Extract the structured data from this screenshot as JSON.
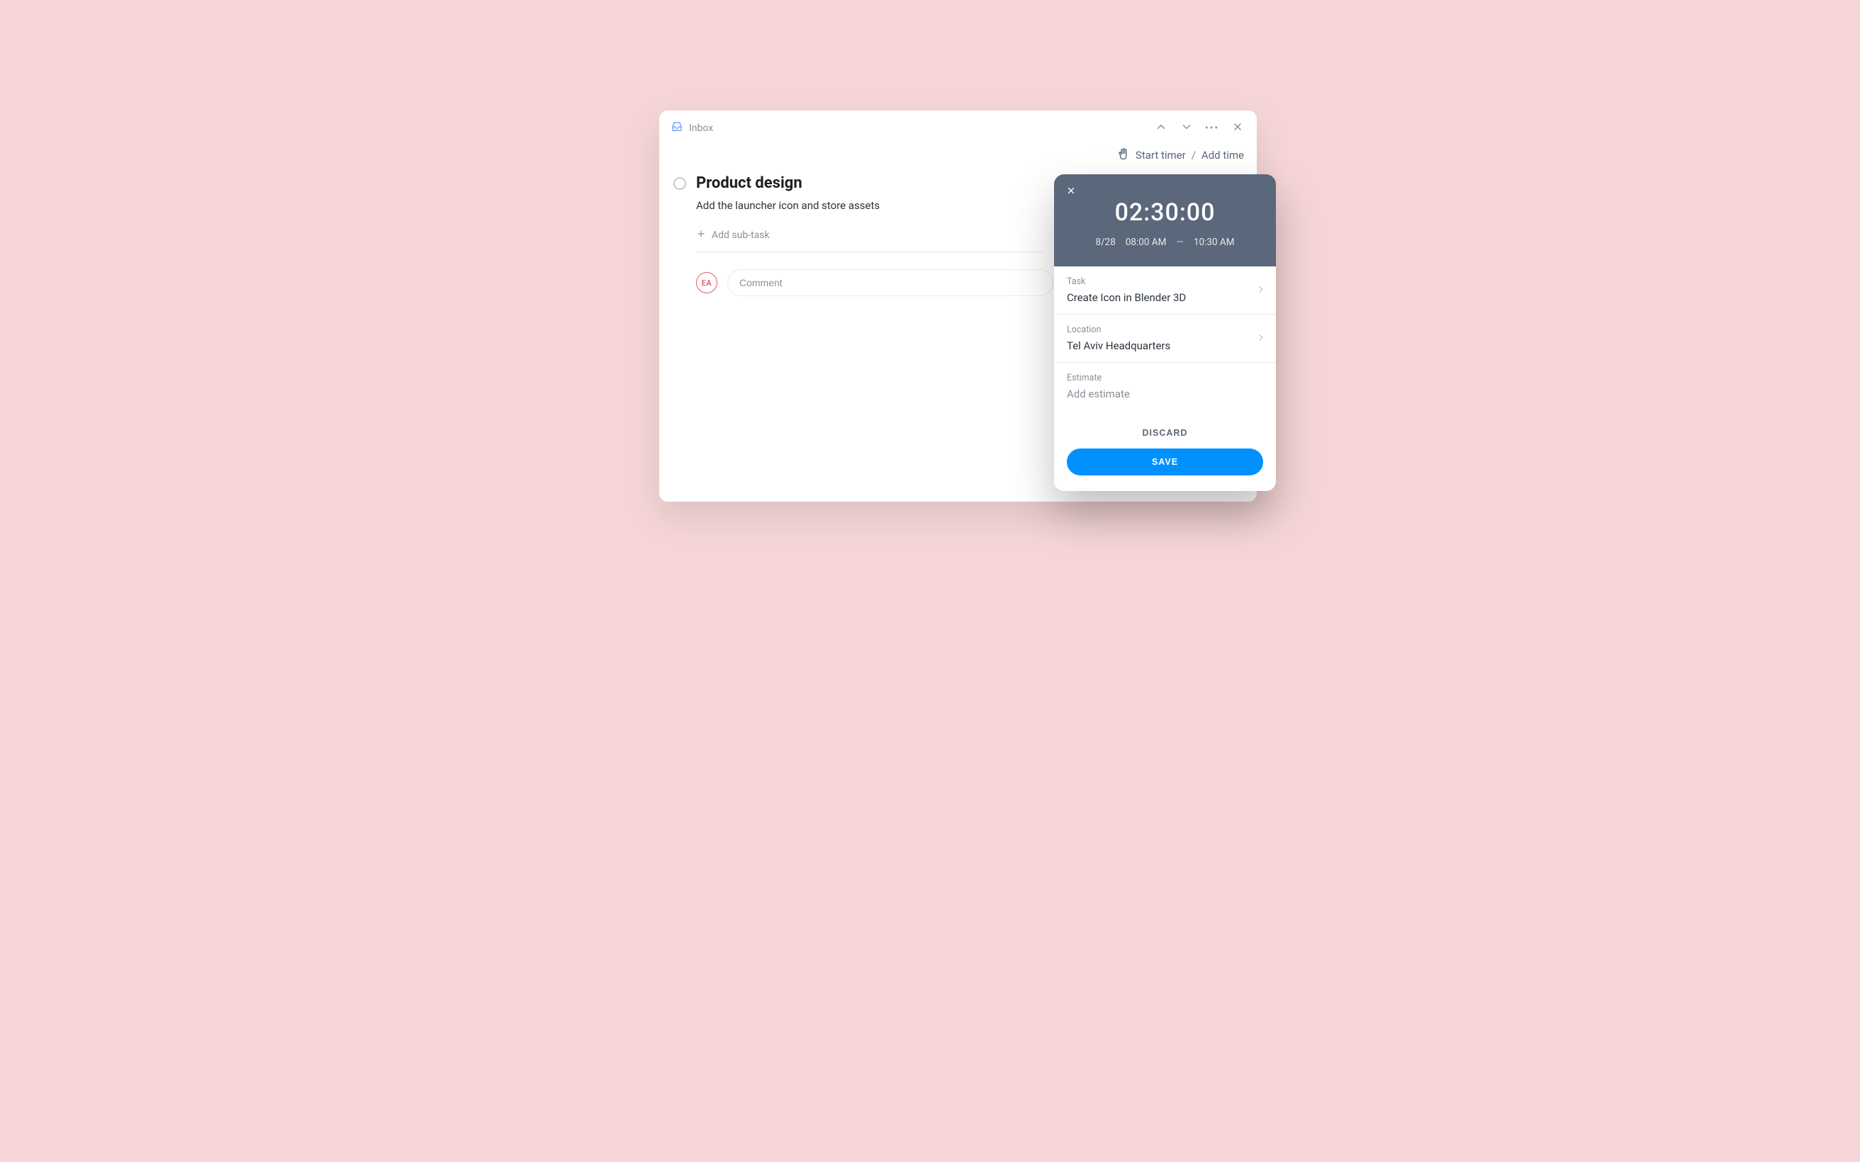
{
  "header": {
    "breadcrumb": "Inbox"
  },
  "timer": {
    "start_label": "Start timer",
    "separator": "/",
    "add_label": "Add time"
  },
  "task": {
    "title": "Product design",
    "description": "Add the launcher icon and store assets",
    "add_subtask_label": "Add sub-task"
  },
  "comment": {
    "avatar_initials": "EA",
    "placeholder": "Comment"
  },
  "popover": {
    "duration": "02:30:00",
    "date": "8/28",
    "start_time": "08:00 AM",
    "end_time": "10:30 AM",
    "fields": {
      "task": {
        "label": "Task",
        "value": "Create Icon in Blender 3D"
      },
      "location": {
        "label": "Location",
        "value": "Tel Aviv Headquarters"
      },
      "estimate": {
        "label": "Estimate",
        "placeholder": "Add estimate"
      }
    },
    "actions": {
      "discard": "DISCARD",
      "save": "SAVE"
    }
  }
}
